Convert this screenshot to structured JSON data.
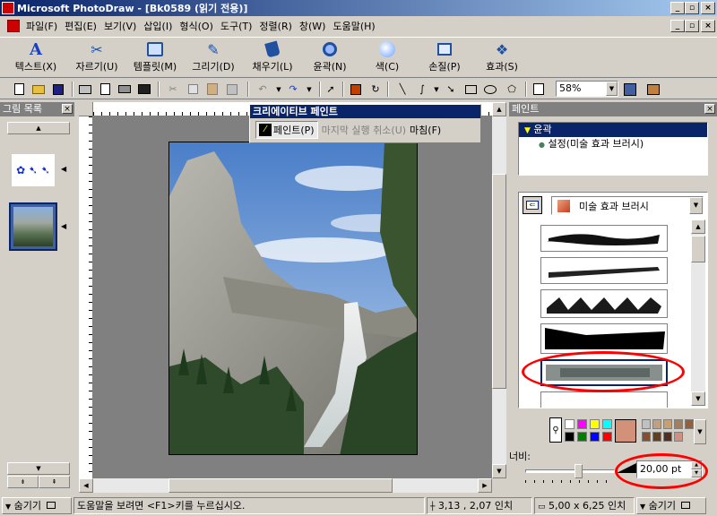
{
  "window": {
    "title": "Microsoft PhotoDraw - [Bk0589 (읽기 전용)]"
  },
  "menu": [
    "파일(F)",
    "편집(E)",
    "보기(V)",
    "삽입(I)",
    "형식(O)",
    "도구(T)",
    "정렬(R)",
    "창(W)",
    "도움말(H)"
  ],
  "big_toolbar": [
    "텍스트(X)",
    "자르기(U)",
    "템플릿(M)",
    "그리기(D)",
    "채우기(L)",
    "윤곽(N)",
    "색(C)",
    "손질(P)",
    "효과(S)"
  ],
  "zoom": "58%",
  "creative_toolbar": {
    "title": "크리에이티브 페인트",
    "paint": "페인트(P)",
    "undo": "마지막 실행 취소(U)",
    "finish": "마침(F)"
  },
  "left_panel": {
    "title": "그림 목록"
  },
  "right_panel": {
    "title": "페인트",
    "tree_root": "윤곽",
    "tree_child": "설정(미술 효과 브러시)",
    "brush_category": "미술 효과 브러시",
    "width_label": "너비:",
    "width_value": "20,00 pt",
    "width_fraction": 0.6
  },
  "palette_colors": [
    "#ffffff",
    "#ff00ff",
    "#ffff00",
    "#00ffff",
    "#000000",
    "#008000",
    "#0000ff",
    "#ff0000"
  ],
  "custom_colors": [
    "#c0c0c0",
    "#c0a080",
    "#c8a070",
    "#a08060",
    "#906040",
    "#805030",
    "#604020",
    "#503020",
    "#d09080"
  ],
  "current_color": "#d4917a",
  "status": {
    "hide_left": "숨기기",
    "help": "도움말을 보려면 <F1>키를 누르십시오.",
    "position": "3,13 , 2,07 인치",
    "size": "5,00 x 6,25 인치",
    "hide_right": "숨기기"
  },
  "colors": {
    "titlebar": "#0a246a",
    "highlight": "#0a246a",
    "annotation": "#ff0000"
  }
}
